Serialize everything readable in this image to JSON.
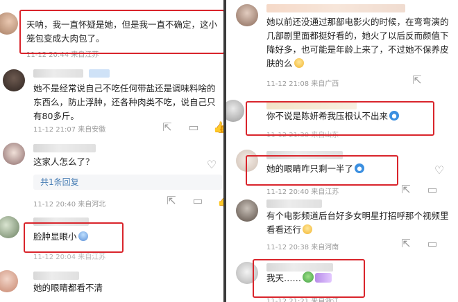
{
  "left": {
    "comments": [
      {
        "text": "天呐，我一直怀疑是她，但是我一直不确定，这小笼包变成大肉包了。",
        "meta": "11-12 20:44 来自江苏"
      },
      {
        "text": "她不是经常说自己不吃任何带盐还是调味料啥的东西么，防止浮肿，还各种肉类不吃，说自己只有80多斤。",
        "meta": "11-12 21:07 来自安徽",
        "likes": "49"
      },
      {
        "text": "这家人怎么了？",
        "reply": "共1条回复",
        "meta": "11-12 20:40 来自河北"
      },
      {
        "text": "脸肿显眼小",
        "meta": "11-12 20:04 来自江苏"
      },
      {
        "text": "她的眼睛都看不清"
      }
    ]
  },
  "right": {
    "comments": [
      {
        "text": "她以前还没通过那部电影火的时候，在弯弯演的几部剧里面都挺好看的，她火了以后反而颜值下降好多，也可能是年龄上来了，不过她不保养皮肤的么",
        "meta": "11-12 21:08 来自广西"
      },
      {
        "text": "你不说是陈妍希我压根认不出来",
        "meta": "11-12 21:30 来自山东"
      },
      {
        "text": "她的眼睛咋只剩一半了",
        "meta": "11-12 20:40 来自江苏"
      },
      {
        "text": "有个电影频道后台好多女明星打招呼那个视频里看看还行",
        "meta": "11-12 20:38 来自河南"
      },
      {
        "text": "我天……",
        "meta": "11-12 21:21 来自浙江"
      }
    ]
  },
  "colors": {
    "highlight": "#d9242b",
    "link": "#4a7fb5"
  }
}
